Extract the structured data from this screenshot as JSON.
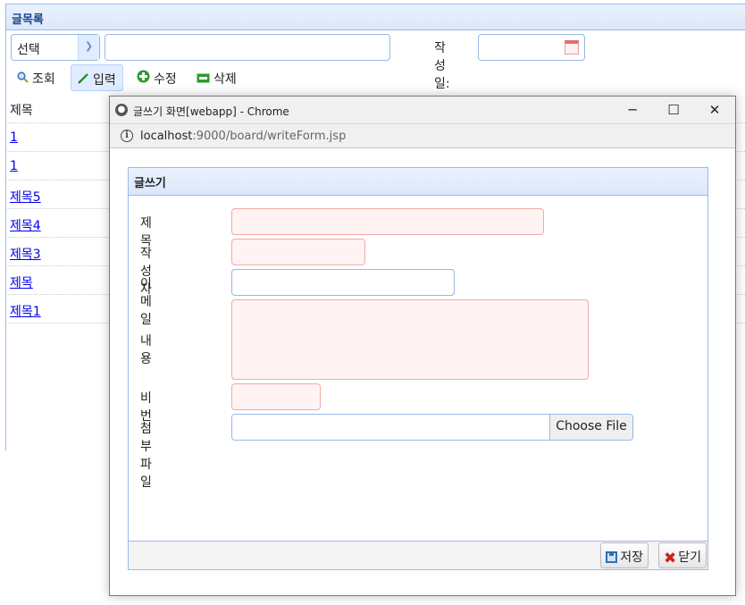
{
  "board": {
    "title": "글목록",
    "search": {
      "select_value": "선택",
      "keyword_value": "",
      "date_label": "작성일:",
      "date_value": ""
    },
    "toolbar": {
      "search": "조회",
      "insert": "입력",
      "update": "수정",
      "delete": "삭제"
    },
    "grid": {
      "column": "제목",
      "rows": [
        "1",
        "1",
        "제목5",
        "제목4",
        "제목3",
        "제목",
        "제목1"
      ]
    }
  },
  "window": {
    "title": "글쓰기 화면[webapp] - Chrome",
    "url_host": "localhost",
    "url_path": ":9000/board/writeForm.jsp",
    "controls": {
      "minimize": "─",
      "maximize": "☐",
      "close": "✕"
    }
  },
  "form": {
    "title": "글쓰기",
    "labels": {
      "title": "제목",
      "writer": "작성자",
      "email": "이메일",
      "content": "내용",
      "password": "비번",
      "attachment": "첨부파일"
    },
    "values": {
      "title": "",
      "writer": "",
      "email": "",
      "content": "",
      "password": ""
    },
    "file_button": "Choose File",
    "buttons": {
      "save": "저장",
      "close": "닫기"
    }
  },
  "colors": {
    "panel_border": "#99bbe8",
    "header_bg": "#dbe8f9",
    "invalid_bg": "#fff3f3",
    "invalid_border": "#f4a9a9"
  }
}
